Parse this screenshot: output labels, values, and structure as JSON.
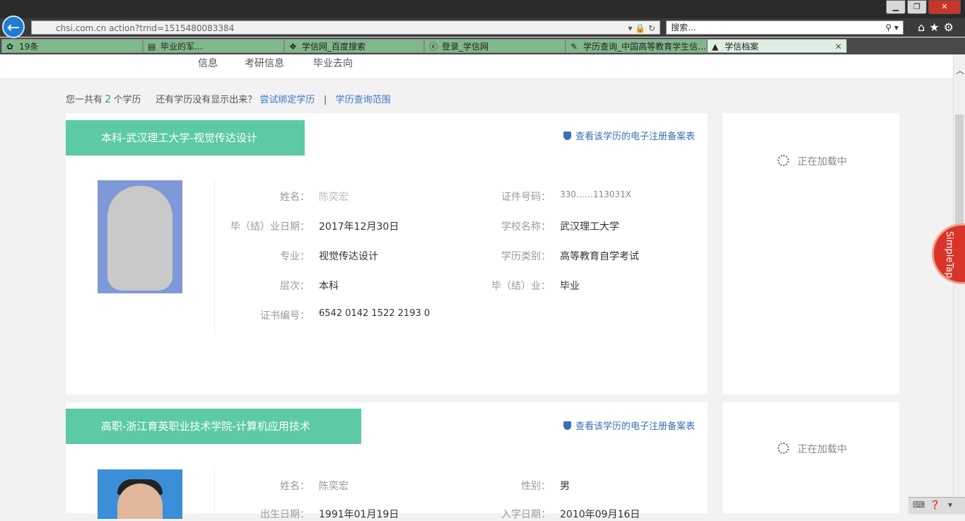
{
  "browser": {
    "url": "chsi.com.cn                                  action?trnd=1515480083384",
    "url_visible": "chsi.com.cn",
    "url_tail": "action?trnd=1515480083384",
    "search_placeholder": "搜索...",
    "window_buttons": [
      "minimize",
      "restore",
      "close"
    ],
    "nav_icons": [
      "home-icon",
      "star-icon",
      "gear-icon"
    ],
    "tabs": [
      {
        "label": "19条",
        "icon": "leaf-icon"
      },
      {
        "label": "毕业的军...",
        "icon": "page-icon"
      },
      {
        "label": "学信网_百度搜索",
        "icon": "paw-icon"
      },
      {
        "label": "登录_学信网",
        "icon": "ie-icon"
      },
      {
        "label": "学历查询_中国高等教育学生信...",
        "icon": "pen-icon"
      },
      {
        "label": "学信档案",
        "icon": "hat-icon",
        "active": true
      }
    ]
  },
  "site_nav": {
    "items": [
      "信息",
      "考研信息",
      "毕业去向"
    ]
  },
  "summary": {
    "prefix": "您一共有",
    "count": "2",
    "suffix": "个学历",
    "question": "还有学历没有显示出来？",
    "bind_link": "尝试绑定学历",
    "separator": "|",
    "scope_link": "学历查询范围"
  },
  "records": [
    {
      "title": "本科-武汉理工大学-视觉传达设计",
      "verify_link": "查看该学历的电子注册备案表",
      "fields": [
        {
          "label": "姓名：",
          "value": "陈奕宏"
        },
        {
          "label": "证件号码：",
          "value": "330……113031X"
        },
        {
          "label": "毕（结）业日期：",
          "value": "2017年12月30日"
        },
        {
          "label": "学校名称：",
          "value": "武汉理工大学"
        },
        {
          "label": "专业：",
          "value": "视觉传达设计"
        },
        {
          "label": "学历类别：",
          "value": "高等教育自学考试"
        },
        {
          "label": "层次：",
          "value": "本科"
        },
        {
          "label": "毕（结）业：",
          "value": "毕业"
        },
        {
          "label": "证书编号：",
          "value": "6542 0142 1522 2193 0"
        }
      ],
      "side_loading": "正在加载中"
    },
    {
      "title": "高职-浙江育英职业技术学院-计算机应用技术",
      "verify_link": "查看该学历的电子注册备案表",
      "fields": [
        {
          "label": "姓名：",
          "value": "陈奕宏"
        },
        {
          "label": "性别：",
          "value": "男"
        },
        {
          "label": "出生日期：",
          "value": "1991年01月19日"
        },
        {
          "label": "入学日期：",
          "value": "2010年09月16日"
        }
      ],
      "side_loading": "正在加载中"
    }
  ],
  "simpletap": {
    "label": "SimpleTap"
  },
  "colors": {
    "header_green": "#5ccaa2",
    "link_blue": "#3a78c0",
    "count_teal": "#26a8a0"
  }
}
